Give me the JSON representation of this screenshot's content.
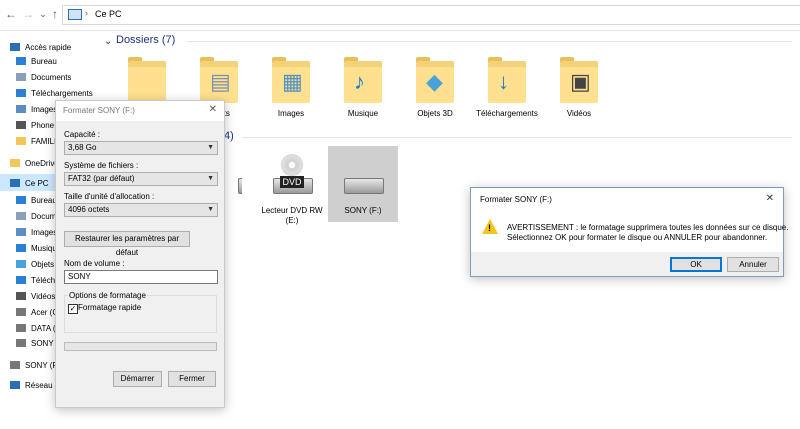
{
  "explorer": {
    "nav": {
      "back": "←",
      "forward": "→",
      "recent": "⌄",
      "up": "↑"
    },
    "address": {
      "separator": "›",
      "location": "Ce PC"
    }
  },
  "sidebar": {
    "items": [
      {
        "label": "Accès rapide",
        "icon": "star-icon",
        "pinned": false
      },
      {
        "label": "Bureau",
        "icon": "desktop-icon",
        "pinned": true
      },
      {
        "label": "Documents",
        "icon": "documents-icon",
        "pinned": true
      },
      {
        "label": "Téléchargements",
        "icon": "download-icon",
        "pinned": true
      },
      {
        "label": "Images",
        "icon": "images-icon",
        "pinned": false
      },
      {
        "label": "Phone",
        "icon": "phone-icon",
        "pinned": false
      },
      {
        "label": "FAMILL",
        "icon": "folder-icon",
        "pinned": false
      },
      {
        "label": "OneDrive",
        "icon": "folder-icon",
        "pinned": false
      },
      {
        "label": "Ce PC",
        "icon": "computer-icon",
        "pinned": false,
        "selected": true
      },
      {
        "label": "Bureau",
        "icon": "desktop-icon",
        "pinned": false
      },
      {
        "label": "Documen",
        "icon": "documents-icon",
        "pinned": false
      },
      {
        "label": "Images",
        "icon": "images-icon",
        "pinned": false
      },
      {
        "label": "Musique",
        "icon": "music-icon",
        "pinned": false
      },
      {
        "label": "Objets",
        "icon": "3d-objects-icon",
        "pinned": false
      },
      {
        "label": "Télécha",
        "icon": "download-icon",
        "pinned": false
      },
      {
        "label": "Vidéos",
        "icon": "videos-icon",
        "pinned": false
      },
      {
        "label": "Acer (C",
        "icon": "drive-icon",
        "pinned": false
      },
      {
        "label": "DATA (D",
        "icon": "drive-icon",
        "pinned": false
      },
      {
        "label": "SONY (",
        "icon": "drive-icon",
        "pinned": false
      },
      {
        "label": "SONY (F:",
        "icon": "drive-icon",
        "pinned": false
      },
      {
        "label": "Réseau",
        "icon": "network-icon",
        "pinned": false
      }
    ]
  },
  "content": {
    "folders_group": "Dossiers (7)",
    "drives_group_count": "4)",
    "folders": [
      {
        "label": "",
        "icon": "desktop-folder-icon"
      },
      {
        "label": "ments",
        "icon": "documents-folder-icon"
      },
      {
        "label": "Images",
        "icon": "images-folder-icon"
      },
      {
        "label": "Musique",
        "icon": "music-folder-icon"
      },
      {
        "label": "Objets 3D",
        "icon": "3d-objects-folder-icon"
      },
      {
        "label": "Téléchargements",
        "icon": "downloads-folder-icon"
      },
      {
        "label": "Vidéos",
        "icon": "videos-folder-icon"
      }
    ],
    "drives": [
      {
        "label": "D:)",
        "icon": "hard-drive-icon"
      },
      {
        "label": "Lecteur DVD RW (E:)",
        "icon": "dvd-drive-icon",
        "badge": "DVD"
      },
      {
        "label": "SONY (F:)",
        "icon": "usb-drive-icon",
        "selected": true
      }
    ]
  },
  "format_dialog": {
    "title": "Formater SONY (F:)",
    "close": "✕",
    "capacity_label": "Capacité :",
    "capacity_value": "3,68 Go",
    "filesystem_label": "Système de fichiers :",
    "filesystem_value": "FAT32 (par défaut)",
    "allocation_label": "Taille d'unité d'allocation :",
    "allocation_value": "4096 octets",
    "restore_button": "Restaurer les paramètres par défaut",
    "volume_label": "Nom de volume :",
    "volume_value": "SONY",
    "options_title": "Options de formatage",
    "quick_format_label": "Formatage rapide",
    "quick_format_checked": true,
    "progress": 0,
    "start_button": "Démarrer",
    "close_button": "Fermer"
  },
  "warning_dialog": {
    "title": "Formater SONY (F:)",
    "close": "✕",
    "line1": "AVERTISSEMENT : le formatage supprimera toutes les données sur ce disque.",
    "line2": "Sélectionnez OK pour formater le disque ou ANNULER pour abandonner.",
    "ok_button": "OK",
    "cancel_button": "Annuler",
    "icon": "warning-icon"
  },
  "colors": {
    "accent": "#1e3287",
    "selection": "#cce8ff",
    "folder": "#ffe08f",
    "warning": "#f5c518",
    "drive_selected": "#cfcfcf"
  }
}
